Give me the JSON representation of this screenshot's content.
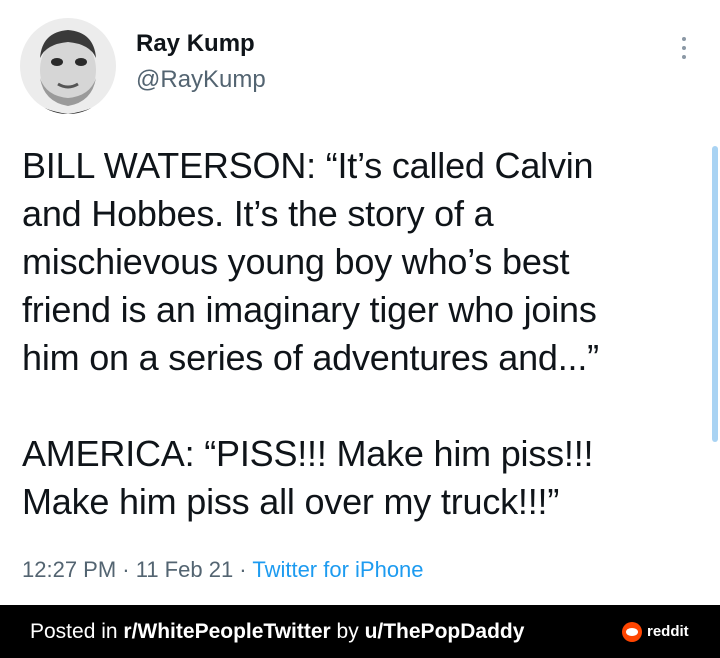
{
  "author": {
    "display_name": "Ray Kump",
    "handle": "@RayKump",
    "avatar_icon": "avatar-photo"
  },
  "tweet": {
    "paragraph_1": "BILL WATERSON: “It’s called Calvin\nand Hobbes. It’s the story of a\nmischievous young boy who’s best\nfriend is an imaginary tiger who joins\nhim on a series of adventures and...”",
    "paragraph_2": "AMERICA: “PISS!!! Make him piss!!!\nMake him piss all over my truck!!!”"
  },
  "meta": {
    "time": "12:27 PM",
    "separator": " · ",
    "date": "11 Feb 21",
    "source": "Twitter for iPhone"
  },
  "footer": {
    "posted_in": "Posted in ",
    "subreddit": "r/WhitePeopleTwitter",
    "by": " by ",
    "user": "u/ThePopDaddy",
    "brand": "reddit",
    "brand_icon": "reddit-logo-icon"
  },
  "colors": {
    "text": "#0f1419",
    "secondary": "#536471",
    "link": "#1d9bf0",
    "footer_bg": "#000000",
    "reddit_orange": "#ff4500"
  }
}
